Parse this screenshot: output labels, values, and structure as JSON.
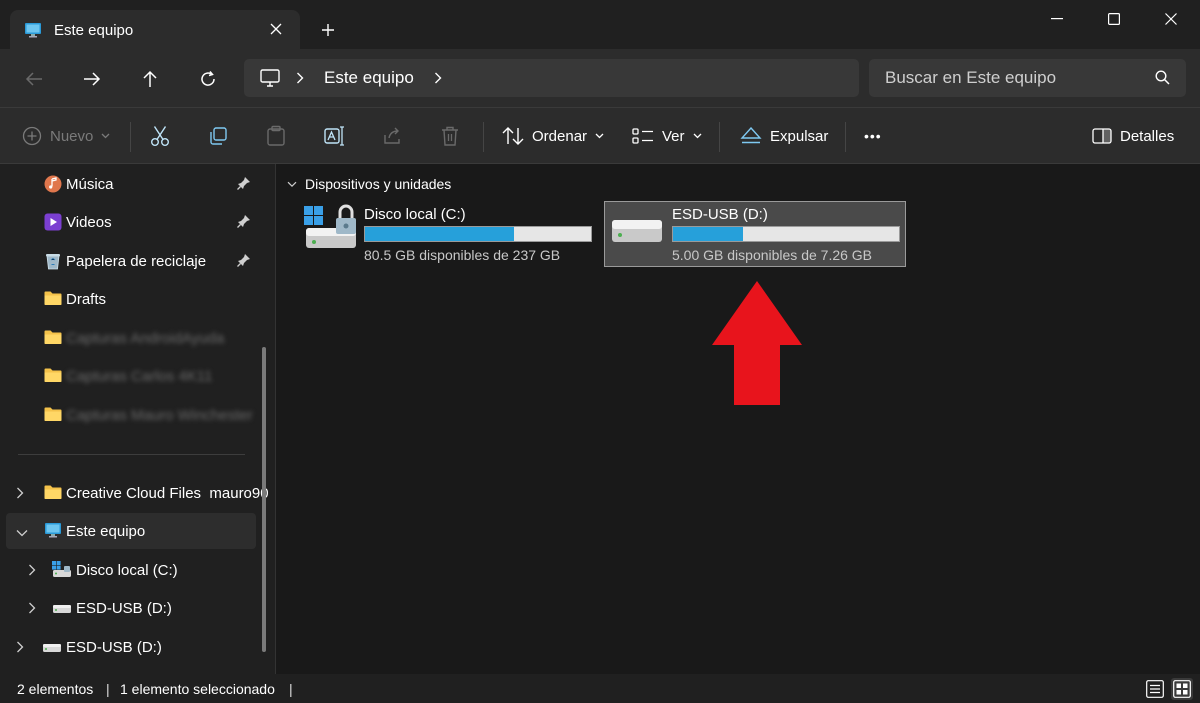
{
  "window": {
    "tab_title": "Este equipo",
    "new_tab_symbol": "+"
  },
  "address": {
    "breadcrumb": "Este equipo",
    "search_placeholder": "Buscar en Este equipo"
  },
  "toolbar": {
    "new_label": "Nuevo",
    "sort_label": "Ordenar",
    "view_label": "Ver",
    "eject_label": "Expulsar",
    "details_label": "Detalles",
    "more_symbol": "•••"
  },
  "sidebar": {
    "pinned": [
      {
        "label": "Música",
        "icon": "music-icon"
      },
      {
        "label": "Videos",
        "icon": "videos-icon"
      },
      {
        "label": "Papelera de reciclaje",
        "icon": "recycle-bin-icon"
      },
      {
        "label": "Drafts",
        "icon": "folder-icon"
      },
      {
        "label": "Capturas AndroidAyuda",
        "icon": "folder-icon",
        "blurred": true
      },
      {
        "label": "Capturas Carlos 4K11",
        "icon": "folder-icon",
        "blurred": true
      },
      {
        "label": "Capturas Mauro Winchester",
        "icon": "folder-icon",
        "blurred": true
      }
    ],
    "tree": [
      {
        "label": "Creative Cloud Files  mauro90",
        "icon": "folder-icon"
      },
      {
        "label": "Este equipo",
        "icon": "computer-icon"
      },
      {
        "label": "Disco local (C:)",
        "icon": "windows-drive-icon"
      },
      {
        "label": "ESD-USB (D:)",
        "icon": "usb-drive-icon"
      },
      {
        "label": "ESD-USB (D:)",
        "icon": "usb-drive-icon"
      }
    ]
  },
  "main": {
    "group_title": "Dispositivos y unidades",
    "drives": [
      {
        "name": "Disco local (C:)",
        "free_text": "80.5 GB disponibles de 237 GB",
        "used_fraction": 0.66
      },
      {
        "name": "ESD-USB (D:)",
        "free_text": "5.00 GB disponibles de 7.26 GB",
        "used_fraction": 0.31
      }
    ]
  },
  "status": {
    "count": "2 elementos",
    "selected": "1 elemento seleccionado",
    "separator": "|"
  },
  "colors": {
    "accent": "#26a0da",
    "arrow": "#e8141c",
    "background": "#191919"
  }
}
